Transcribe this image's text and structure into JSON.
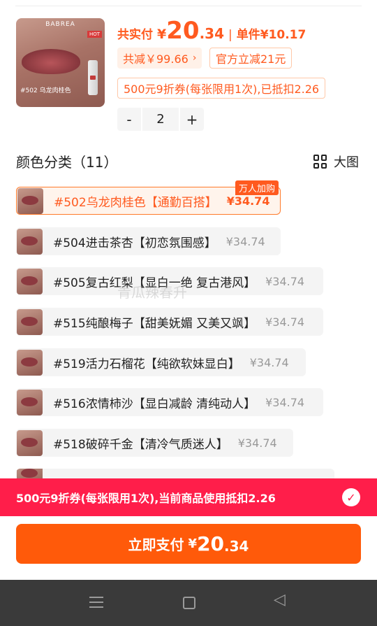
{
  "product": {
    "brand": "BABREA",
    "hot_badge": "HOT",
    "image_label": "#502 乌龙肉桂色"
  },
  "price": {
    "actual_label": "共实付",
    "currency": "¥",
    "actual_int": "20",
    "actual_dec": ".34",
    "separator": "|",
    "unit_label": "单件¥10.17"
  },
  "tags": {
    "total_discount": "共减￥99.66",
    "official_discount": "官方立减21元",
    "coupon": "500元9折券(每张限用1次),已抵扣2.26"
  },
  "stepper": {
    "minus": "-",
    "quantity": "2",
    "plus": "+"
  },
  "color_section": {
    "title": "颜色分类（11）",
    "view_toggle_label": "大图"
  },
  "variants": [
    {
      "name": "#502乌龙肉桂色【通勤百搭】",
      "price": "¥34.74",
      "badge": "万人加购",
      "selected": true
    },
    {
      "name": "#504进击茶杏【初恋氛围感】",
      "price": "¥34.74"
    },
    {
      "name": "#505复古红梨【显白一绝 复古港风】",
      "price": "¥34.74"
    },
    {
      "name": "#515纯酿梅子【甜美妩媚 又美又飒】",
      "price": "¥34.74"
    },
    {
      "name": "#519活力石榴花【纯欲软妹显白】",
      "price": "¥34.74"
    },
    {
      "name": "#516浓情柿沙【显白减龄 清纯动人】",
      "price": "¥34.74"
    },
    {
      "name": "#518破碎千金【清冷气质迷人】",
      "price": "¥34.74"
    }
  ],
  "watermark": "青瓜辣春升",
  "coupon_bar": {
    "text": "500元9折券(每张限用1次),当前商品使用抵扣2.26",
    "check": "✓"
  },
  "pay_button": {
    "label": "立即支付",
    "currency": "¥",
    "int": "20",
    "dec": ".34"
  },
  "nav": {
    "back_glyph": "◁"
  }
}
